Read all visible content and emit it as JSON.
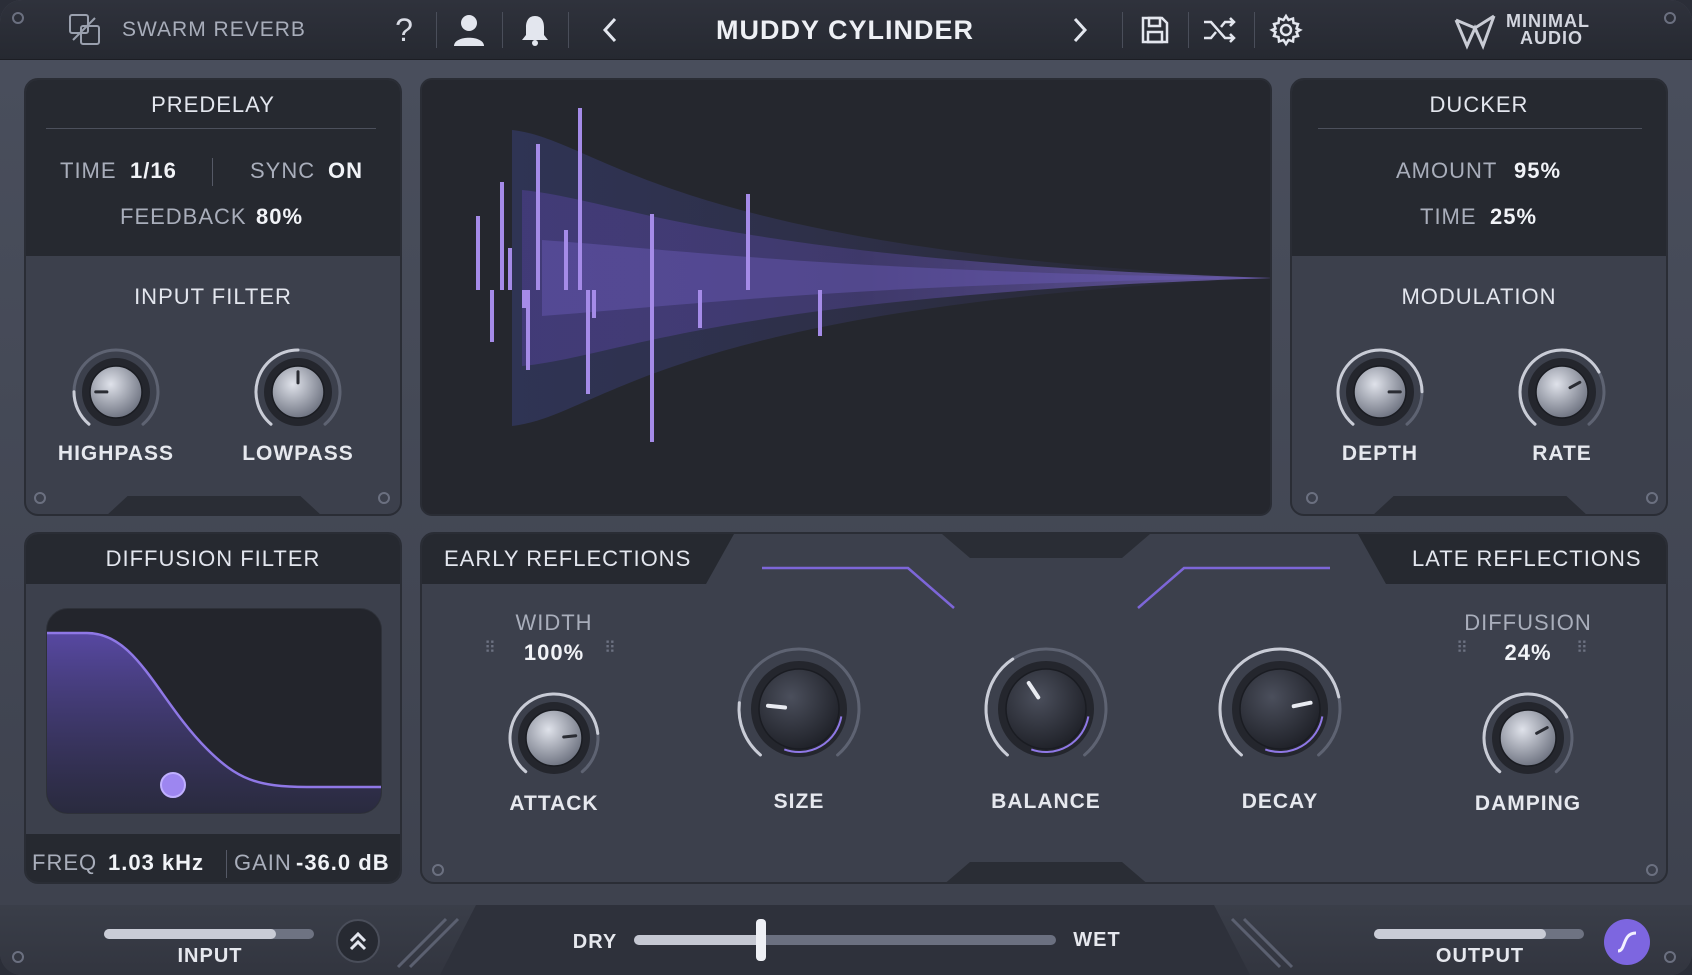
{
  "header": {
    "plugin_name": "SWARM REVERB",
    "preset_name": "MUDDY CYLINDER",
    "help_glyph": "?",
    "prev_glyph": "‹",
    "next_glyph": "›",
    "icons": [
      "plugin-logo-icon",
      "help-icon",
      "user-icon",
      "bell-icon",
      "chevron-left-icon",
      "chevron-right-icon",
      "save-icon",
      "shuffle-icon",
      "gear-icon"
    ],
    "brand_line1": "MINIMAL",
    "brand_line2": "AUDIO"
  },
  "predelay": {
    "title": "PREDELAY",
    "time_label": "TIME",
    "time_value": "1/16",
    "sync_label": "SYNC",
    "sync_value": "ON",
    "feedback_label": "FEEDBACK",
    "feedback_value": "80%"
  },
  "input_filter": {
    "title": "INPUT FILTER",
    "highpass_label": "HIGHPASS",
    "highpass_level": 0.18,
    "lowpass_label": "LOWPASS",
    "lowpass_level": 0.5
  },
  "ducker": {
    "title": "DUCKER",
    "amount_label": "AMOUNT",
    "amount_value": "95%",
    "time_label": "TIME",
    "time_value": "25%"
  },
  "modulation": {
    "title": "MODULATION",
    "depth_label": "DEPTH",
    "depth_level": 0.82,
    "rate_label": "RATE",
    "rate_level": 0.72
  },
  "diffusion_filter": {
    "title": "DIFFUSION FILTER",
    "freq_label": "FREQ",
    "freq_value": "1.03 kHz",
    "gain_label": "GAIN",
    "gain_value": "-36.0 dB"
  },
  "early_reflections": {
    "title": "EARLY REFLECTIONS",
    "width_label": "WIDTH",
    "width_value": "100%",
    "attack_label": "ATTACK",
    "attack_level": 0.8
  },
  "center_knobs": {
    "size_label": "SIZE",
    "size_level": 0.2,
    "balance_label": "BALANCE",
    "balance_level": 0.38,
    "decay_label": "DECAY",
    "decay_level": 0.78
  },
  "late_reflections": {
    "title": "LATE REFLECTIONS",
    "diffusion_label": "DIFFUSION",
    "diffusion_value": "24%",
    "damping_label": "DAMPING",
    "damping_level": 0.72
  },
  "footer": {
    "input_label": "INPUT",
    "input_level": 0.82,
    "dry_label": "DRY",
    "wet_label": "WET",
    "mix_level": 0.3,
    "output_label": "OUTPUT",
    "output_level": 0.82
  },
  "colors": {
    "accent": "#8f78e6",
    "accent_bright": "#b48cf0",
    "panel": "#3c404c",
    "dark": "#262930"
  }
}
